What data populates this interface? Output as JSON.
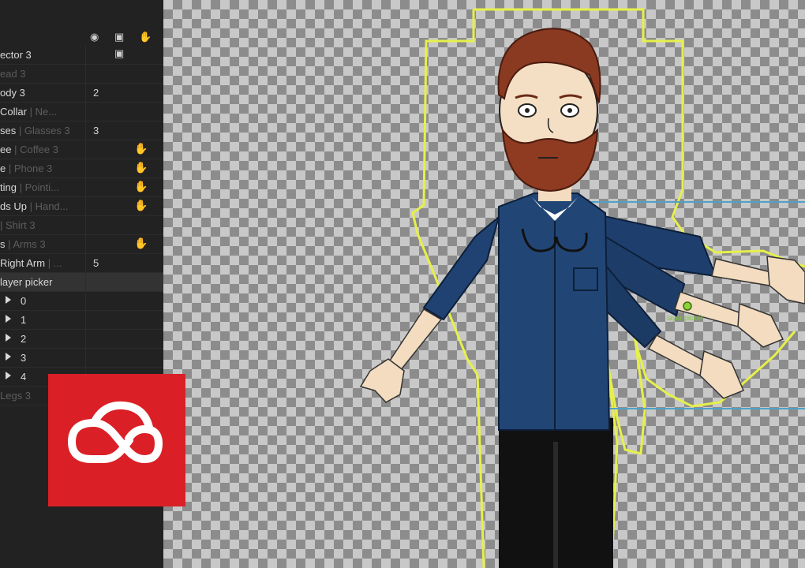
{
  "panel": {
    "rows": [
      {
        "name": "ector 3",
        "sub": ""
      },
      {
        "name": "ead 3",
        "sub": "",
        "dim": true
      },
      {
        "name": "ody 3",
        "sub": "",
        "count": "2"
      },
      {
        "name": " Collar",
        "sub": " | Ne..."
      },
      {
        "name": "ses",
        "sub": " | Glasses 3",
        "count": "3"
      },
      {
        "name": "ee",
        "sub": " | Coffee 3",
        "hand": true
      },
      {
        "name": "e",
        "sub": " | Phone 3",
        "hand": true
      },
      {
        "name": "ting",
        "sub": " | Pointi...",
        "hand": true
      },
      {
        "name": "ds Up",
        "sub": " | Hand...",
        "hand": true
      },
      {
        "name": "",
        "sub": " | Shirt 3"
      },
      {
        "name": "s",
        "sub": " | Arms 3",
        "hand": true
      },
      {
        "name": " Right Arm",
        "sub": " | ...",
        "count": "5"
      },
      {
        "name": "layer picker",
        "sub": "",
        "picker": true
      },
      {
        "name": "0",
        "sub": "",
        "sel": true
      },
      {
        "name": "1",
        "sub": "",
        "sel": true
      },
      {
        "name": "2",
        "sub": "",
        "sel": true
      },
      {
        "name": "3",
        "sub": "",
        "sel": true
      },
      {
        "name": "4",
        "sub": "",
        "sel": true
      },
      {
        "name": "",
        "sub": " Legs 3",
        "dim": true
      }
    ]
  },
  "stage": {
    "handle_label": "layer picker"
  },
  "colors": {
    "outline": "#e6f04a",
    "selection": "#4fa2c8",
    "logo_red": "#da1f26"
  },
  "icons": {
    "record": "record-icon",
    "camera": "camera-icon",
    "hand": "hand-icon"
  }
}
